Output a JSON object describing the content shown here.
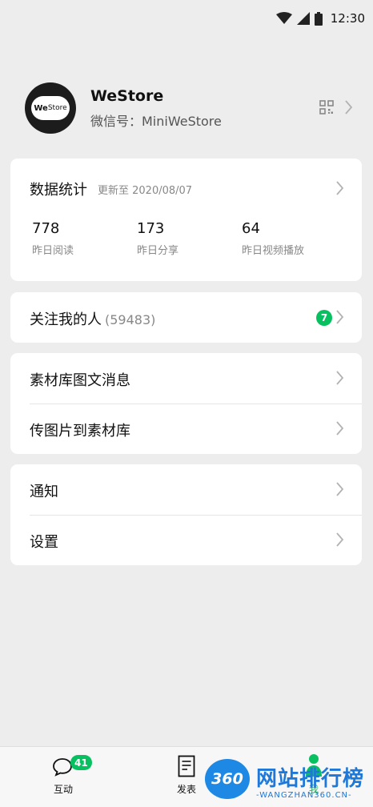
{
  "status_bar": {
    "time": "12:30",
    "icons": [
      "wifi-icon",
      "cellular-icon",
      "battery-icon"
    ]
  },
  "profile": {
    "avatar_logo": "We",
    "avatar_logo_suffix": "Store",
    "name": "WeStore",
    "id_label": "微信号：MiniWeStore",
    "icons": [
      "qr-code-icon",
      "chevron-right-icon"
    ]
  },
  "stats": {
    "title": "数据统计",
    "updated": "更新至 2020/08/07",
    "items": [
      {
        "value": "778",
        "label": "昨日阅读"
      },
      {
        "value": "173",
        "label": "昨日分享"
      },
      {
        "value": "64",
        "label": "昨日视频播放"
      }
    ]
  },
  "followers": {
    "label": "关注我的人",
    "count": "(59483)",
    "badge": "7"
  },
  "materials": {
    "items": [
      {
        "label": "素材库图文消息"
      },
      {
        "label": "传图片到素材库"
      }
    ]
  },
  "misc": {
    "items": [
      {
        "label": "通知"
      },
      {
        "label": "设置"
      }
    ]
  },
  "tab_bar": {
    "tabs": [
      {
        "label": "互动",
        "badge": "41",
        "icon": "chat-bubble-icon"
      },
      {
        "label": "发表",
        "icon": "document-icon"
      },
      {
        "label": "我",
        "icon": "person-icon"
      }
    ]
  },
  "watermark": {
    "logo": "360",
    "text": "网站排行榜",
    "url": "-WANGZHAN360.CN-"
  },
  "colors": {
    "accent": "#07c160",
    "background": "#ededed",
    "card": "#ffffff"
  }
}
